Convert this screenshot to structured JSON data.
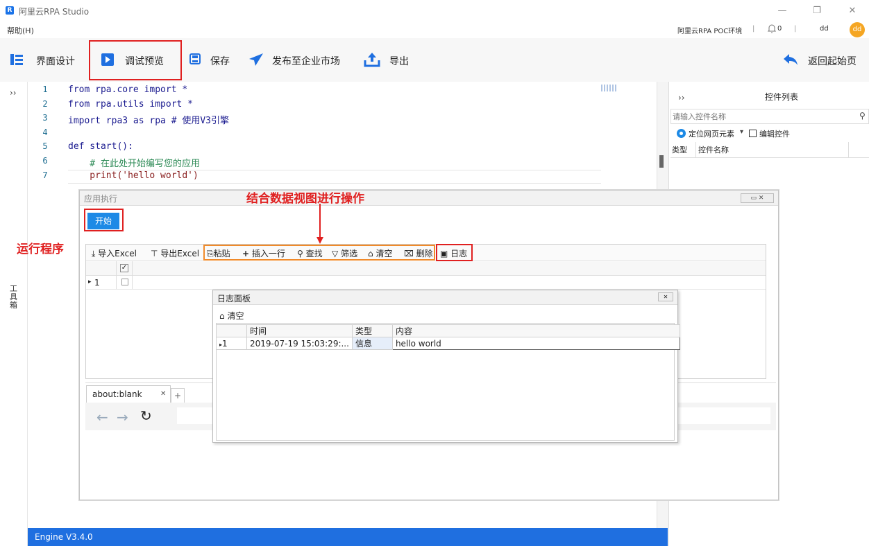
{
  "window": {
    "title": "阿里云RPA Studio",
    "minimize_glyph": "—",
    "restore_glyph": "❐",
    "close_glyph": "✕"
  },
  "menubar": {
    "help": "帮助(H)",
    "env": "阿里云RPA POC环境",
    "sep1": "|",
    "notif_count": "0",
    "sep2": "|",
    "user": "dd",
    "avatar": "dd"
  },
  "toolbar": {
    "design": "界面设计",
    "debug": "调试预览",
    "save": "保存",
    "publish": "发布至企业市场",
    "export": "导出",
    "back": "返回起始页"
  },
  "editor": {
    "collapse": "››",
    "toolbox": "工具箱",
    "lines": [
      {
        "num": "1",
        "code": "from rpa.core import *"
      },
      {
        "num": "2",
        "code": "from rpa.utils import *"
      },
      {
        "num": "3",
        "code": "import rpa3 as rpa # 使用V3引擎"
      },
      {
        "num": "4",
        "code": ""
      },
      {
        "num": "5",
        "code": "def start():"
      },
      {
        "num": "6",
        "code": "    # 在此处开始编写您的应用"
      },
      {
        "num": "7",
        "code": "    print('hello world')"
      }
    ]
  },
  "right_panel": {
    "collapse": "››",
    "title": "控件列表",
    "search_placeholder": "请输入控件名称",
    "locate": "定位网页元素",
    "edit": "编辑控件",
    "col_type": "类型",
    "col_name": "控件名称"
  },
  "status": {
    "engine": "Engine V3.4.0"
  },
  "exec_window": {
    "title": "应用执行",
    "start": "开始",
    "toolbar": {
      "import_excel": "导入Excel",
      "export_excel": "导出Excel",
      "paste": "粘贴",
      "insert_row": "插入一行",
      "find": "查找",
      "filter": "筛选",
      "clear": "清空",
      "delete": "删除",
      "log": "日志"
    },
    "row_num": "1",
    "browser_tab": "about:blank",
    "browser_tab_close": "✕",
    "new_tab": "+"
  },
  "annotations": {
    "combine": "结合数据视图进行操作",
    "run": "运行程序"
  },
  "log_panel": {
    "title": "日志面板",
    "close": "✕",
    "clear": "清空",
    "headers": [
      "时间",
      "类型",
      "内容"
    ],
    "rows": [
      {
        "num": "1",
        "time": "2019-07-19 15:03:29:...",
        "type": "信息",
        "content": "hello world"
      }
    ]
  },
  "colors": {
    "accent": "#1f6fe0",
    "annotation": "#e02020",
    "start_button": "#1d8ae6"
  }
}
